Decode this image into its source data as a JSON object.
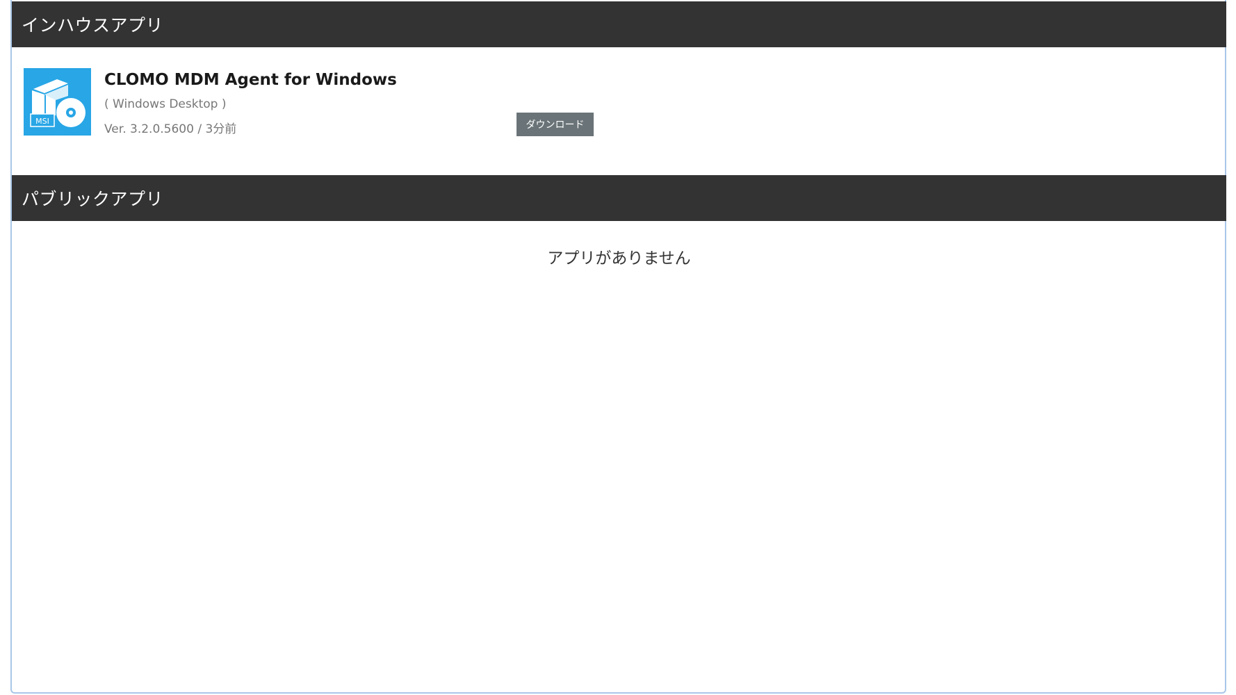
{
  "sections": {
    "inhouse": {
      "title": "インハウスアプリ",
      "apps": [
        {
          "name": "CLOMO MDM Agent for Windows",
          "platform": "( Windows Desktop )",
          "version": "Ver. 3.2.0.5600 / 3分前",
          "icon": "msi-installer-icon",
          "icon_label": "MSI",
          "download_label": "ダウンロード"
        }
      ]
    },
    "public": {
      "title": "パブリックアプリ",
      "empty_message": "アプリがありません"
    }
  },
  "colors": {
    "header_bg": "#333333",
    "icon_bg": "#28a6e6",
    "button_bg": "#6a7478"
  }
}
